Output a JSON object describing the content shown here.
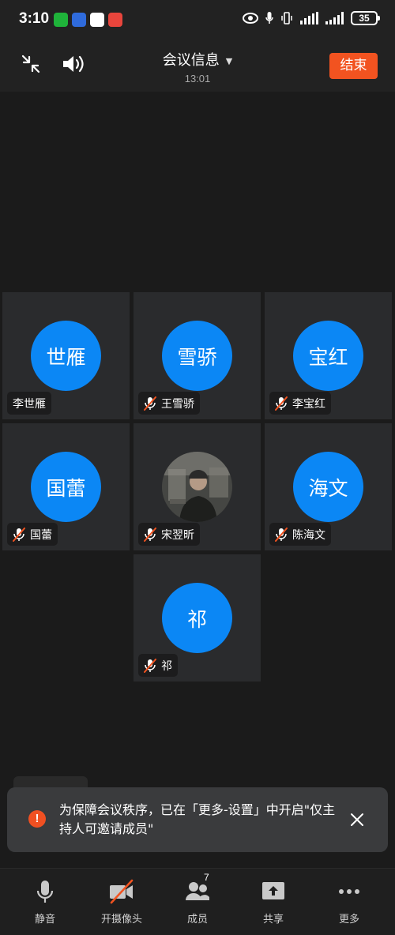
{
  "status_bar": {
    "time": "3:10",
    "battery": "35",
    "app_icons": [
      {
        "name": "wechat-icon",
        "color": "#1fb33a"
      },
      {
        "name": "browser-icon",
        "color": "#2f6bdc"
      },
      {
        "name": "qq-icon",
        "color": "#ffffff"
      },
      {
        "name": "app-red-icon",
        "color": "#e8453c"
      }
    ]
  },
  "header": {
    "title": "会议信息",
    "time": "13:01",
    "end_label": "结束"
  },
  "participants": [
    {
      "avatar_text": "世雁",
      "name": "李世雁",
      "muted": false,
      "photo": false
    },
    {
      "avatar_text": "雪骄",
      "name": "王雪骄",
      "muted": true,
      "photo": false
    },
    {
      "avatar_text": "宝红",
      "name": "李宝红",
      "muted": true,
      "photo": false
    },
    {
      "avatar_text": "国蕾",
      "name": "国蕾",
      "muted": true,
      "photo": false
    },
    {
      "avatar_text": "",
      "name": "宋翌昕",
      "muted": true,
      "photo": true
    },
    {
      "avatar_text": "海文",
      "name": "陈海文",
      "muted": true,
      "photo": false
    },
    {
      "avatar_text": "祁",
      "name": "祁",
      "muted": true,
      "photo": false
    }
  ],
  "toast": {
    "message": "为保障会议秩序，已在「更多-设置」中开启\"仅主持人可邀请成员\"",
    "icon": "!"
  },
  "toolbar": {
    "mute_label": "静音",
    "camera_label": "开摄像头",
    "members_label": "成员",
    "members_count": "7",
    "share_label": "共享",
    "more_label": "更多"
  },
  "colors": {
    "accent_blue": "#0b87f5",
    "end_orange": "#f25320",
    "mute_red": "#f25320"
  }
}
